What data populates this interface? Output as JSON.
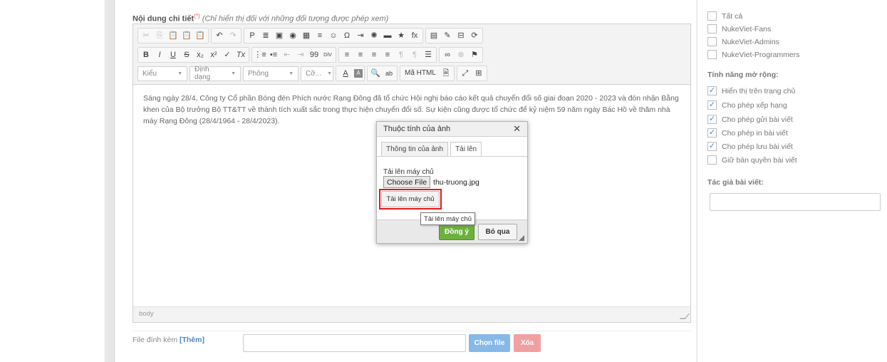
{
  "content": {
    "title": "Nội dung chi tiết",
    "required_mark": "(*)",
    "note": "(Chỉ hiển thị đối với những đối tượng được phép xem)",
    "body_text": "Sáng ngày 28/4, Công ty Cổ phần Bóng đèn Phích nước Rạng Đông  đã tổ chức Hội nghị báo cáo kết quả chuyển đổi số giai đoạn 2020 - 2023 và đón nhận Bằng khen của Bộ trưởng Bộ TT&TT về thành tích xuất sắc trong thực hiện chuyển đổi số. Sự kiện cũng được tổ chức để kỷ niệm 59 năm ngày Bác Hồ về thăm nhà máy Rạng Đông (28/4/1964 - 28/4/2023).",
    "status_path": "body"
  },
  "toolbar": {
    "row1": [
      "✂",
      "⎘",
      "📋",
      "📋",
      "📋",
      "↶",
      "↷",
      "P",
      "≣",
      "▣",
      "◉",
      "▦",
      "≡",
      "☺",
      "Ω",
      "⇥",
      "✺",
      "▬",
      "★",
      "fx",
      "▤",
      "✎",
      "⊟",
      "⟳"
    ],
    "row2": [
      "B",
      "I",
      "U",
      "S",
      "x₂",
      "x²",
      "✓",
      "Tx",
      "⋮≡",
      "•≡",
      "⇤",
      "⇥",
      "99",
      "DIV",
      "≡",
      "≡",
      "≡",
      "≡",
      "¶",
      "¶",
      "☰",
      "∞",
      "⊗",
      "⚑"
    ],
    "style_label": "Kiểu",
    "format_label": "Định dạng",
    "font_label": "Phông",
    "size_label": "Cỡ...",
    "text_color": "A",
    "bg_color": "A",
    "find": "🔍",
    "replace": "ab",
    "source_label": "Mã HTML",
    "doc": "🗎",
    "maximize": "⤢",
    "blocks": "⊞"
  },
  "attachment": {
    "label": "File đính kèm ",
    "add_link": "[Thêm]",
    "choose_button": "Chọn file",
    "delete_button": "Xóa"
  },
  "right": {
    "groups": [
      {
        "label": "Tất cả",
        "checked": false
      },
      {
        "label": "NukeViet-Fans",
        "checked": false
      },
      {
        "label": "NukeViet-Admins",
        "checked": false
      },
      {
        "label": "NukeViet-Programmers",
        "checked": false
      }
    ],
    "features_title": "Tính năng mở rộng:",
    "features": [
      {
        "label": "Hiển thị trên trang chủ",
        "checked": true
      },
      {
        "label": "Cho phép xếp hạng",
        "checked": true
      },
      {
        "label": "Cho phép gửi bài viết",
        "checked": true
      },
      {
        "label": "Cho phép in bài viết",
        "checked": true
      },
      {
        "label": "Cho phép lưu bài viết",
        "checked": true
      },
      {
        "label": "Giữ bản quyền bài viết",
        "checked": false
      }
    ],
    "author_title": "Tác giả bài viết:"
  },
  "dialog": {
    "title": "Thuộc tính của ảnh",
    "close": "✕",
    "tab_info": "Thông tin của ảnh",
    "tab_upload": "Tải lên",
    "upload_label": "Tải lên máy chủ",
    "choose_file": "Choose File",
    "file_name": "thu-truong.jpg",
    "upload_button": "Tải lên máy chủ",
    "tooltip": "Tải lên máy chủ",
    "ok": "Đồng ý",
    "cancel": "Bỏ qua"
  }
}
